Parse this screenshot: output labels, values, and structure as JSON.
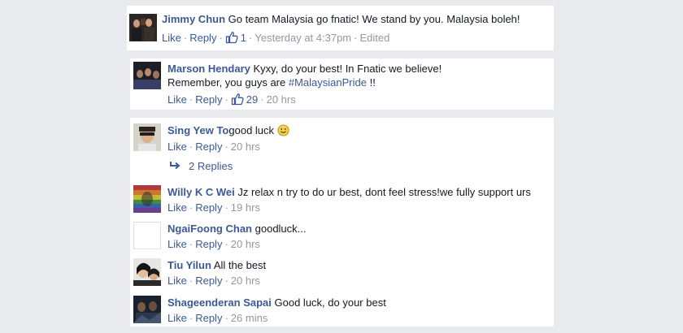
{
  "comments": [
    {
      "author": "Jimmy Chun",
      "text": "Go team Malaysia go fnatic! We stand by you. Malaysia boleh!",
      "like": "Like",
      "reply": "Reply",
      "likes": "1",
      "time": "Yesterday at 4:37pm",
      "edited": "Edited"
    },
    {
      "author": "Marson Hendary",
      "text_line1": "Kyxy, do your best! In Fnatic we believe!",
      "text_line2_prefix": "Remember, you guys are ",
      "hashtag": "#MalaysianPride",
      "text_line2_suffix": " !!",
      "like": "Like",
      "reply": "Reply",
      "likes": "29",
      "time": "20 hrs"
    },
    {
      "author": "Sing Yew To",
      "text": "good luck",
      "emoji": "smiley-icon",
      "like": "Like",
      "reply": "Reply",
      "time": "20 hrs",
      "replies": "2 Replies"
    },
    {
      "author": "Willy K C Wei",
      "text": "Jz relax n try to do ur best, dont feel stress!we fully support urs",
      "like": "Like",
      "reply": "Reply",
      "time": "19 hrs"
    },
    {
      "author": "NgaiFoong Chan",
      "text": "goodluck...",
      "like": "Like",
      "reply": "Reply",
      "time": "20 hrs"
    },
    {
      "author": "Tiu Yilun",
      "text": "All the best",
      "like": "Like",
      "reply": "Reply",
      "time": "20 hrs"
    },
    {
      "author": "Shageenderan Sapai",
      "text": "Good luck, do your best",
      "like": "Like",
      "reply": "Reply",
      "time": "26 mins"
    }
  ],
  "colors": {
    "background": "#e9eaed",
    "link": "#3b5998",
    "meta": "#9197a3",
    "text": "#141823"
  }
}
